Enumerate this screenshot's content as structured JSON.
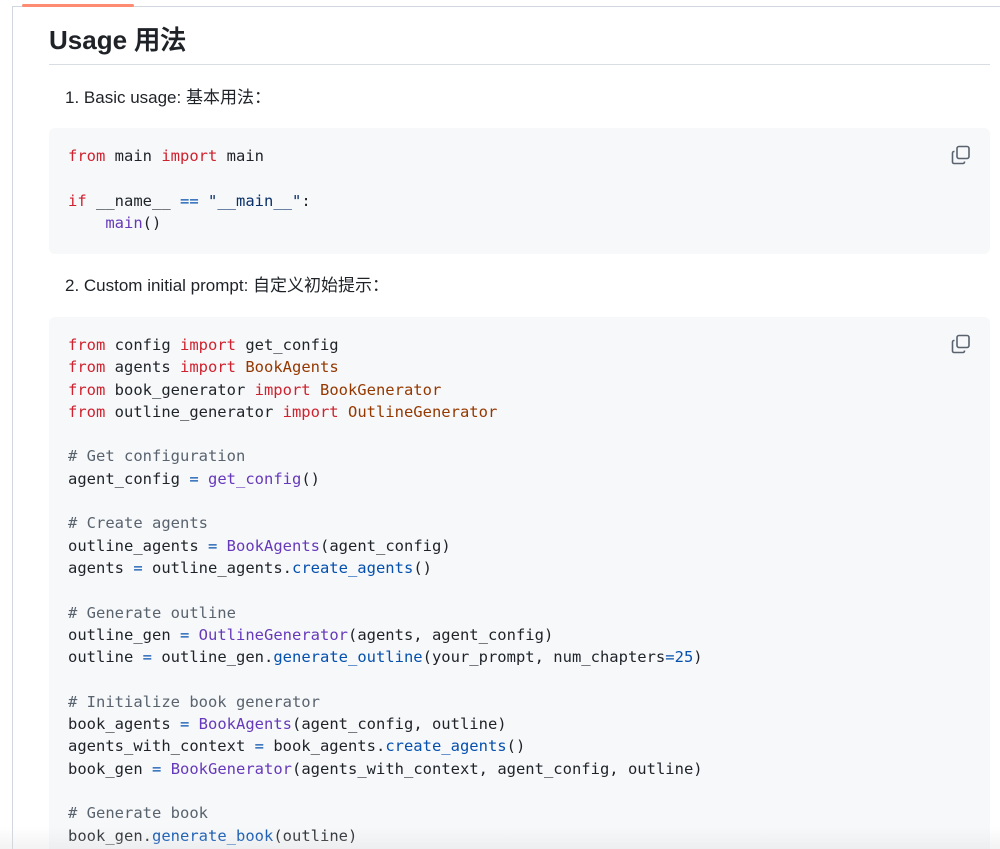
{
  "section": {
    "heading": "Usage 用法"
  },
  "items": [
    {
      "label": "1. Basic usage:  基本用法：",
      "code_lines": [
        [
          [
            "kw",
            "from"
          ],
          [
            "t",
            " main "
          ],
          [
            "kw",
            "import"
          ],
          [
            "t",
            " main"
          ]
        ],
        [],
        [
          [
            "kw",
            "if"
          ],
          [
            "t",
            " __name__ "
          ],
          [
            "op",
            "=="
          ],
          [
            "t",
            " "
          ],
          [
            "str",
            "\"__main__\""
          ],
          [
            "t",
            ":"
          ]
        ],
        [
          [
            "t",
            "    "
          ],
          [
            "fn",
            "main"
          ],
          [
            "t",
            "()"
          ]
        ]
      ]
    },
    {
      "label": "2. Custom initial prompt:  自定义初始提示：",
      "code_lines": [
        [
          [
            "kw",
            "from"
          ],
          [
            "t",
            " config "
          ],
          [
            "kw",
            "import"
          ],
          [
            "t",
            " get_config"
          ]
        ],
        [
          [
            "kw",
            "from"
          ],
          [
            "t",
            " agents "
          ],
          [
            "kw",
            "import"
          ],
          [
            "t",
            " "
          ],
          [
            "cls",
            "BookAgents"
          ]
        ],
        [
          [
            "kw",
            "from"
          ],
          [
            "t",
            " book_generator "
          ],
          [
            "kw",
            "import"
          ],
          [
            "t",
            " "
          ],
          [
            "cls",
            "BookGenerator"
          ]
        ],
        [
          [
            "kw",
            "from"
          ],
          [
            "t",
            " outline_generator "
          ],
          [
            "kw",
            "import"
          ],
          [
            "t",
            " "
          ],
          [
            "cls",
            "OutlineGenerator"
          ]
        ],
        [],
        [
          [
            "cm",
            "# Get configuration"
          ]
        ],
        [
          [
            "t",
            "agent_config "
          ],
          [
            "op",
            "="
          ],
          [
            "t",
            " "
          ],
          [
            "fn",
            "get_config"
          ],
          [
            "t",
            "()"
          ]
        ],
        [],
        [
          [
            "cm",
            "# Create agents"
          ]
        ],
        [
          [
            "t",
            "outline_agents "
          ],
          [
            "op",
            "="
          ],
          [
            "t",
            " "
          ],
          [
            "fn",
            "BookAgents"
          ],
          [
            "t",
            "(agent_config)"
          ]
        ],
        [
          [
            "t",
            "agents "
          ],
          [
            "op",
            "="
          ],
          [
            "t",
            " outline_agents."
          ],
          [
            "op",
            "create_agents"
          ],
          [
            "t",
            "()"
          ]
        ],
        [],
        [
          [
            "cm",
            "# Generate outline"
          ]
        ],
        [
          [
            "t",
            "outline_gen "
          ],
          [
            "op",
            "="
          ],
          [
            "t",
            " "
          ],
          [
            "fn",
            "OutlineGenerator"
          ],
          [
            "t",
            "(agents, agent_config)"
          ]
        ],
        [
          [
            "t",
            "outline "
          ],
          [
            "op",
            "="
          ],
          [
            "t",
            " outline_gen."
          ],
          [
            "op",
            "generate_outline"
          ],
          [
            "t",
            "(your_prompt, num_chapters"
          ],
          [
            "op",
            "=25"
          ],
          [
            "t",
            ")"
          ]
        ],
        [],
        [
          [
            "cm",
            "# Initialize book generator"
          ]
        ],
        [
          [
            "t",
            "book_agents "
          ],
          [
            "op",
            "="
          ],
          [
            "t",
            " "
          ],
          [
            "fn",
            "BookAgents"
          ],
          [
            "t",
            "(agent_config, outline)"
          ]
        ],
        [
          [
            "t",
            "agents_with_context "
          ],
          [
            "op",
            "="
          ],
          [
            "t",
            " book_agents."
          ],
          [
            "op",
            "create_agents"
          ],
          [
            "t",
            "()"
          ]
        ],
        [
          [
            "t",
            "book_gen "
          ],
          [
            "op",
            "="
          ],
          [
            "t",
            " "
          ],
          [
            "fn",
            "BookGenerator"
          ],
          [
            "t",
            "(agents_with_context, agent_config, outline)"
          ]
        ],
        [],
        [
          [
            "cm",
            "# Generate book"
          ]
        ],
        [
          [
            "t",
            "book_gen."
          ],
          [
            "op",
            "generate_book"
          ],
          [
            "t",
            "(outline)"
          ]
        ]
      ]
    }
  ],
  "icons": {
    "copy": "copy-icon"
  },
  "colors": {
    "keyword": "#cf222e",
    "function": "#6639ba",
    "class": "#953800",
    "string": "#0a3069",
    "comment": "#59636e",
    "operator": "#0550ae",
    "code_background": "#f6f8fa",
    "tab_underline": "#fd8c73"
  }
}
